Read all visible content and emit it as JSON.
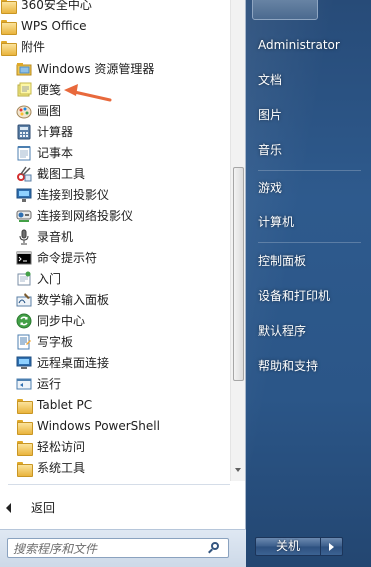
{
  "programs": {
    "top_items": [
      {
        "label": "360安全中心",
        "icon": "folder-icon"
      },
      {
        "label": "WPS Office",
        "icon": "folder-icon"
      },
      {
        "label": "附件",
        "icon": "folder-icon"
      }
    ],
    "sub_items": [
      {
        "label": "Windows 资源管理器",
        "icon": "explorer-icon"
      },
      {
        "label": "便笺",
        "icon": "sticky-notes-icon"
      },
      {
        "label": "画图",
        "icon": "paint-icon"
      },
      {
        "label": "计算器",
        "icon": "calculator-icon"
      },
      {
        "label": "记事本",
        "icon": "notepad-icon"
      },
      {
        "label": "截图工具",
        "icon": "snipping-tool-icon"
      },
      {
        "label": "连接到投影仪",
        "icon": "projector-icon"
      },
      {
        "label": "连接到网络投影仪",
        "icon": "network-projector-icon"
      },
      {
        "label": "录音机",
        "icon": "microphone-icon"
      },
      {
        "label": "命令提示符",
        "icon": "cmd-icon"
      },
      {
        "label": "入门",
        "icon": "getting-started-icon"
      },
      {
        "label": "数学输入面板",
        "icon": "math-input-icon"
      },
      {
        "label": "同步中心",
        "icon": "sync-center-icon"
      },
      {
        "label": "写字板",
        "icon": "wordpad-icon"
      },
      {
        "label": "远程桌面连接",
        "icon": "remote-desktop-icon"
      },
      {
        "label": "运行",
        "icon": "run-icon"
      },
      {
        "label": "Tablet PC",
        "icon": "folder-icon"
      },
      {
        "label": "Windows PowerShell",
        "icon": "folder-icon"
      },
      {
        "label": "轻松访问",
        "icon": "folder-icon"
      },
      {
        "label": "系统工具",
        "icon": "folder-icon"
      }
    ],
    "back_label": "返回"
  },
  "search": {
    "placeholder": "搜索程序和文件",
    "icon": "search-icon"
  },
  "right_pane": {
    "items": [
      {
        "label": "Administrator"
      },
      {
        "label": "文档"
      },
      {
        "label": "图片"
      },
      {
        "label": "音乐"
      },
      {
        "label": "游戏"
      },
      {
        "label": "计算机"
      },
      {
        "label": "控制面板"
      },
      {
        "label": "设备和打印机"
      },
      {
        "label": "默认程序"
      },
      {
        "label": "帮助和支持"
      }
    ],
    "shutdown_label": "关机"
  },
  "colors": {
    "right_pane_blue": "#2b5688",
    "annotation_arrow": "#e8693c",
    "folder_yellow": "#e9b43d"
  }
}
